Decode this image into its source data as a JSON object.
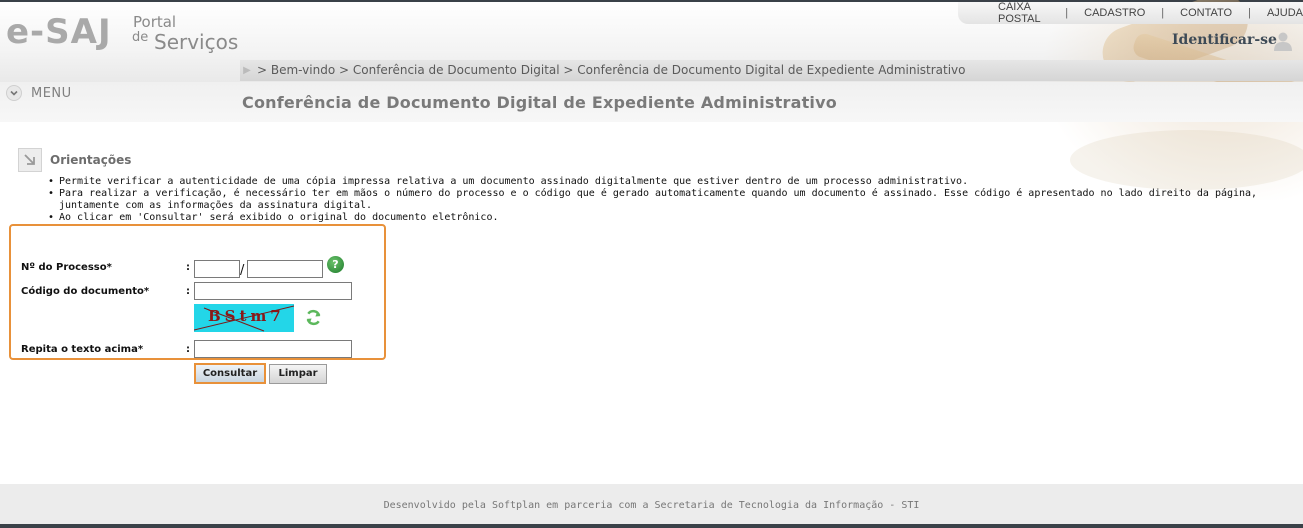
{
  "header": {
    "logo": {
      "brand": "e-SAJ",
      "portal": "Portal",
      "de": "de",
      "servicos": "Serviços"
    },
    "topnav": [
      "CAIXA POSTAL",
      "CADASTRO",
      "CONTATO",
      "AJUDA"
    ],
    "identify_label": "Identificar-se",
    "breadcrumb": "> Bem-vindo > Conferência de Documento Digital > Conferência de Documento Digital de Expediente Administrativo"
  },
  "menu": {
    "label": "MENU"
  },
  "page": {
    "title": "Conferência de Documento Digital de Expediente Administrativo"
  },
  "orientacoes": {
    "title": "Orientações",
    "items": [
      "Permite verificar a autenticidade de uma cópia impressa relativa a um documento assinado digitalmente que estiver dentro de um processo administrativo.",
      "Para realizar a verificação, é necessário ter em mãos o número do processo e o código que é gerado automaticamente quando um documento é assinado. Esse código é apresentado no lado direito da página, juntamente com as informações da assinatura digital.",
      "Ao clicar em 'Consultar' será exibido o original do documento eletrônico."
    ]
  },
  "form": {
    "processo_label": "Nº do Processo*",
    "codigo_label": "Código do documento*",
    "repita_label": "Repita o texto acima*",
    "colon": ":",
    "slash": "/",
    "help_glyph": "?",
    "captcha_text": "BStm7",
    "consultar_label": "Consultar",
    "limpar_label": "Limpar"
  },
  "footer": {
    "text": "Desenvolvido pela Softplan em parceria com a Secretaria de Tecnologia da Informação - STI"
  },
  "colors": {
    "accent_orange": "#e8913a",
    "captcha_bg": "#23d6e8",
    "help_green": "#1c7a2a"
  }
}
